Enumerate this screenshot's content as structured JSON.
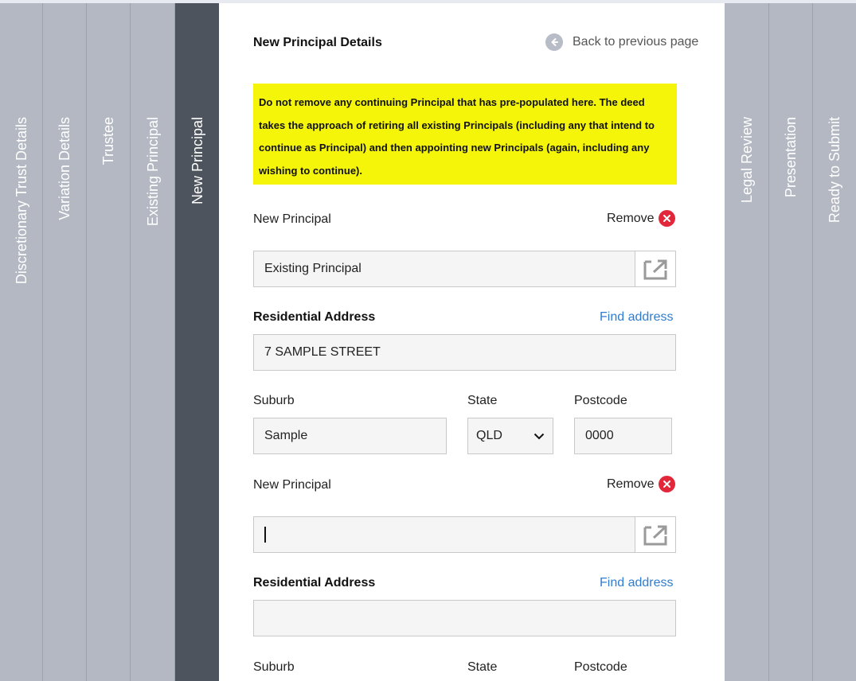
{
  "tabs": [
    {
      "label": "Discretionary Trust Details"
    },
    {
      "label": "Variation Details"
    },
    {
      "label": "Trustee"
    },
    {
      "label": "Existing Principal"
    },
    {
      "label": "New Principal"
    },
    {
      "label": "Legal Review"
    },
    {
      "label": "Presentation"
    },
    {
      "label": "Ready to Submit"
    }
  ],
  "header": {
    "title": "New Principal Details",
    "back_label": "Back to previous page"
  },
  "notice": {
    "text": "Do not remove any continuing Principal that has pre-populated here. The deed takes the approach of retiring all existing Principals (including any that intend to continue as Principal) and then appointing new Principals (again, including any wishing to continue)."
  },
  "principals": [
    {
      "label": "New Principal",
      "remove_label": "Remove",
      "name_value": "Existing Principal",
      "address_label": "Residential Address",
      "find_address_label": "Find address",
      "address_value": "7 SAMPLE STREET",
      "suburb_label": "Suburb",
      "state_label": "State",
      "postcode_label": "Postcode",
      "suburb_value": "Sample",
      "state_value": "QLD",
      "postcode_value": "0000"
    },
    {
      "label": "New Principal",
      "remove_label": "Remove",
      "name_value": "",
      "address_label": "Residential Address",
      "find_address_label": "Find address",
      "address_value": "",
      "suburb_label": "Suburb",
      "state_label": "State",
      "postcode_label": "Postcode"
    }
  ],
  "colors": {
    "tab_bg": "#b3b8c2",
    "tab_active_bg": "#4e545e",
    "notice_bg": "#f5f50a",
    "link": "#2f7dd1",
    "remove_icon": "#e3273b"
  },
  "icons": {
    "back": "arrow-left-circle-icon",
    "remove": "close-circle-icon",
    "open": "external-link-icon",
    "select": "chevron-down-icon"
  }
}
